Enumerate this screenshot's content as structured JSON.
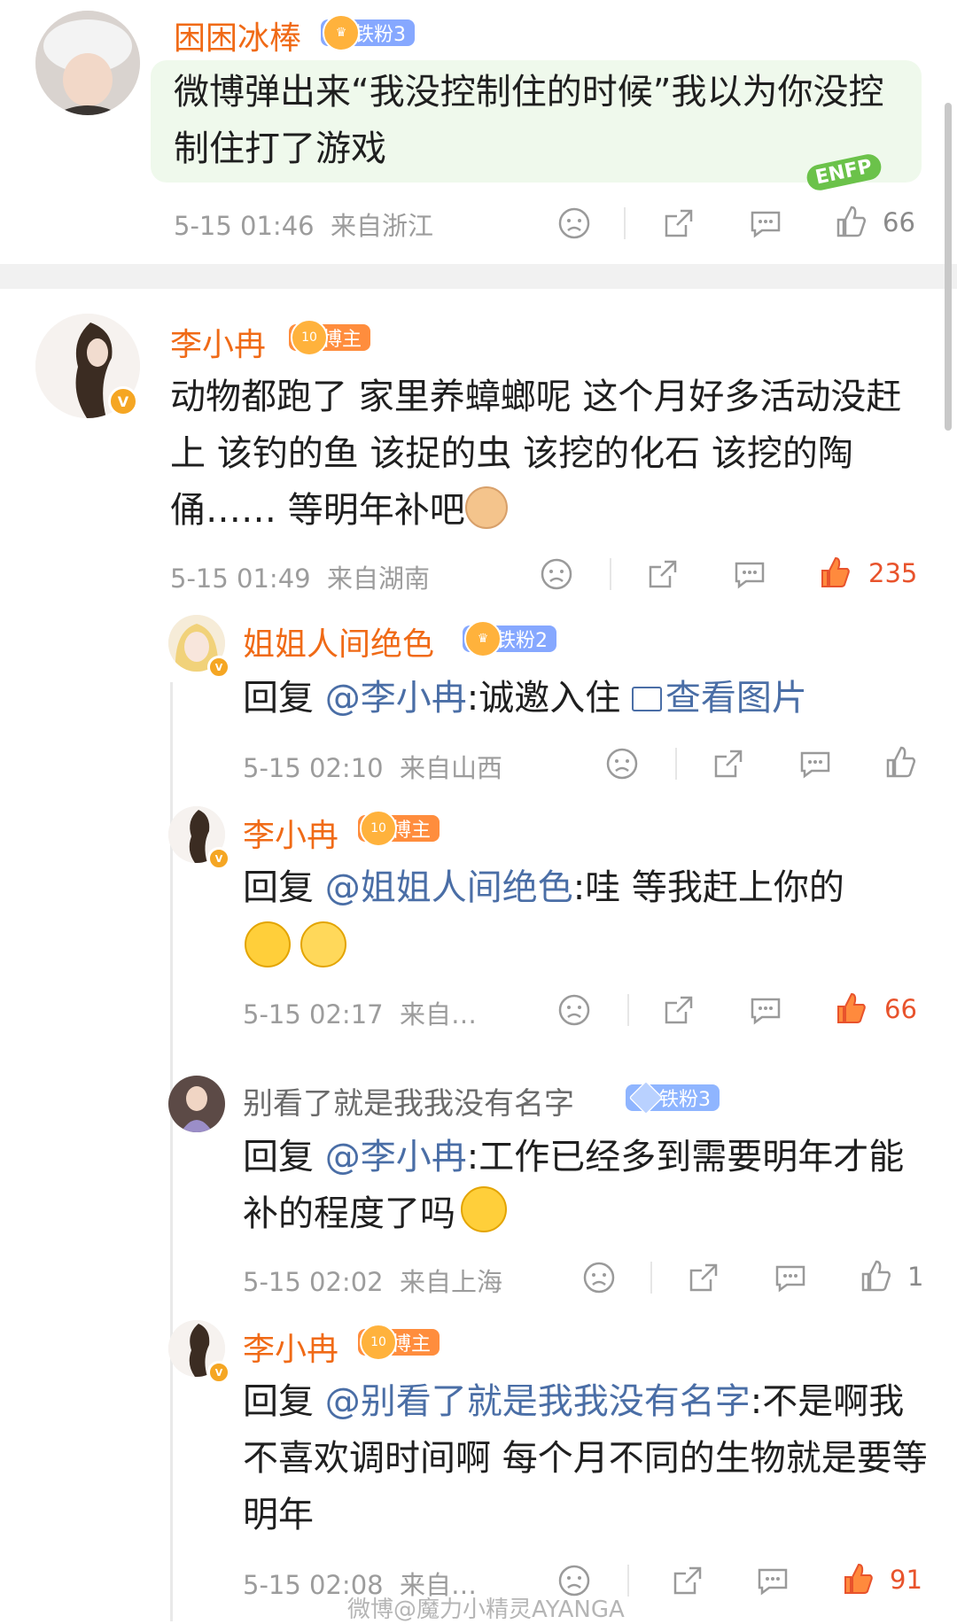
{
  "comments": [
    {
      "user": "困困冰棒",
      "badge": "铁粉3",
      "text": "微博弹出来“我没控制住的时候”我以为你没控制住打了游戏",
      "time": "5-15 01:46",
      "location": "来自浙江",
      "likes": "66",
      "sticker": "ENFP"
    },
    {
      "user": "李小冉",
      "badge": "博主",
      "text": "动物都跑了 家里养蟑螂呢 这个月好多活动没赶上 该钓的鱼 该捉的虫 该挖的化石 该挖的陶俑…… 等明年补吧",
      "time": "5-15 01:49",
      "location": "来自湖南",
      "likes": "235"
    }
  ],
  "replies": [
    {
      "user": "姐姐人间绝色",
      "badge": "铁粉2",
      "prefix": "回复",
      "mention": "@李小冉",
      "text": ":诚邀入住",
      "link": "查看图片",
      "time": "5-15 02:10",
      "location": "来自山西",
      "likes": ""
    },
    {
      "user": "李小冉",
      "badge": "博主",
      "prefix": "回复",
      "mention": "@姐姐人间绝色",
      "text": ":哇 等我赶上你的",
      "time": "5-15 02:17",
      "location": "来自…",
      "likes": "66"
    },
    {
      "user": "别看了就是我我没有名字",
      "badge": "铁粉3",
      "prefix": "回复",
      "mention": "@李小冉",
      "text": ":工作已经多到需要明年才能补的程度了吗",
      "time": "5-15 02:02",
      "location": "来自上海",
      "likes": "1"
    },
    {
      "user": "李小冉",
      "badge": "博主",
      "prefix": "回复",
      "mention": "@别看了就是我我没有名字",
      "text": ":不是啊我不喜欢调时间啊 每个月不同的生物就是要等明年",
      "time": "5-15 02:08",
      "location": "来自…",
      "likes": "91"
    }
  ],
  "watermark": "微博@魔力小精灵AYANGA",
  "colors": {
    "username": "#f06a16",
    "mention": "#4a6ea6",
    "hot_like": "#e8532c"
  }
}
